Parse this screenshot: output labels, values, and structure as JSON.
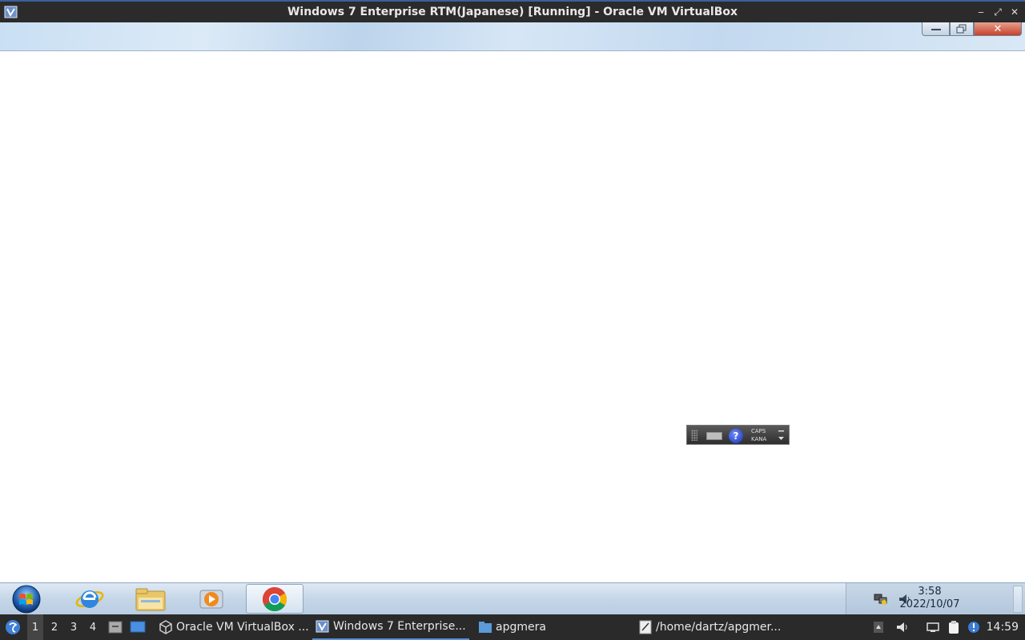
{
  "host_window": {
    "title": "Windows 7 Enterprise RTM(Japanese) [Running] - Oracle VM VirtualBox",
    "controls": {
      "minimize": "‒",
      "maximize": "⤢",
      "close": "✕"
    }
  },
  "guest_window_controls": {
    "close": "✕"
  },
  "language_bar": {
    "help": "?",
    "caps": "CAPS",
    "kana": "KANA"
  },
  "guest_taskbar": {
    "pinned_apps": [
      "Internet Explorer",
      "Windows Explorer",
      "Windows Media Player",
      "Google Chrome"
    ],
    "clock": {
      "time": "3:58",
      "date": "2022/10/07"
    }
  },
  "host_panel": {
    "workspaces": [
      "1",
      "2",
      "3",
      "4"
    ],
    "tasks": [
      {
        "label": "Oracle VM VirtualBox ...",
        "icon": "virtualbox-icon"
      },
      {
        "label": "Windows 7 Enterprise...",
        "icon": "vm-window-icon"
      },
      {
        "label": "apgmera",
        "icon": "folder-icon"
      },
      {
        "label": "/home/dartz/apgmer...",
        "icon": "text-editor-icon"
      }
    ],
    "clock": "14:59"
  }
}
